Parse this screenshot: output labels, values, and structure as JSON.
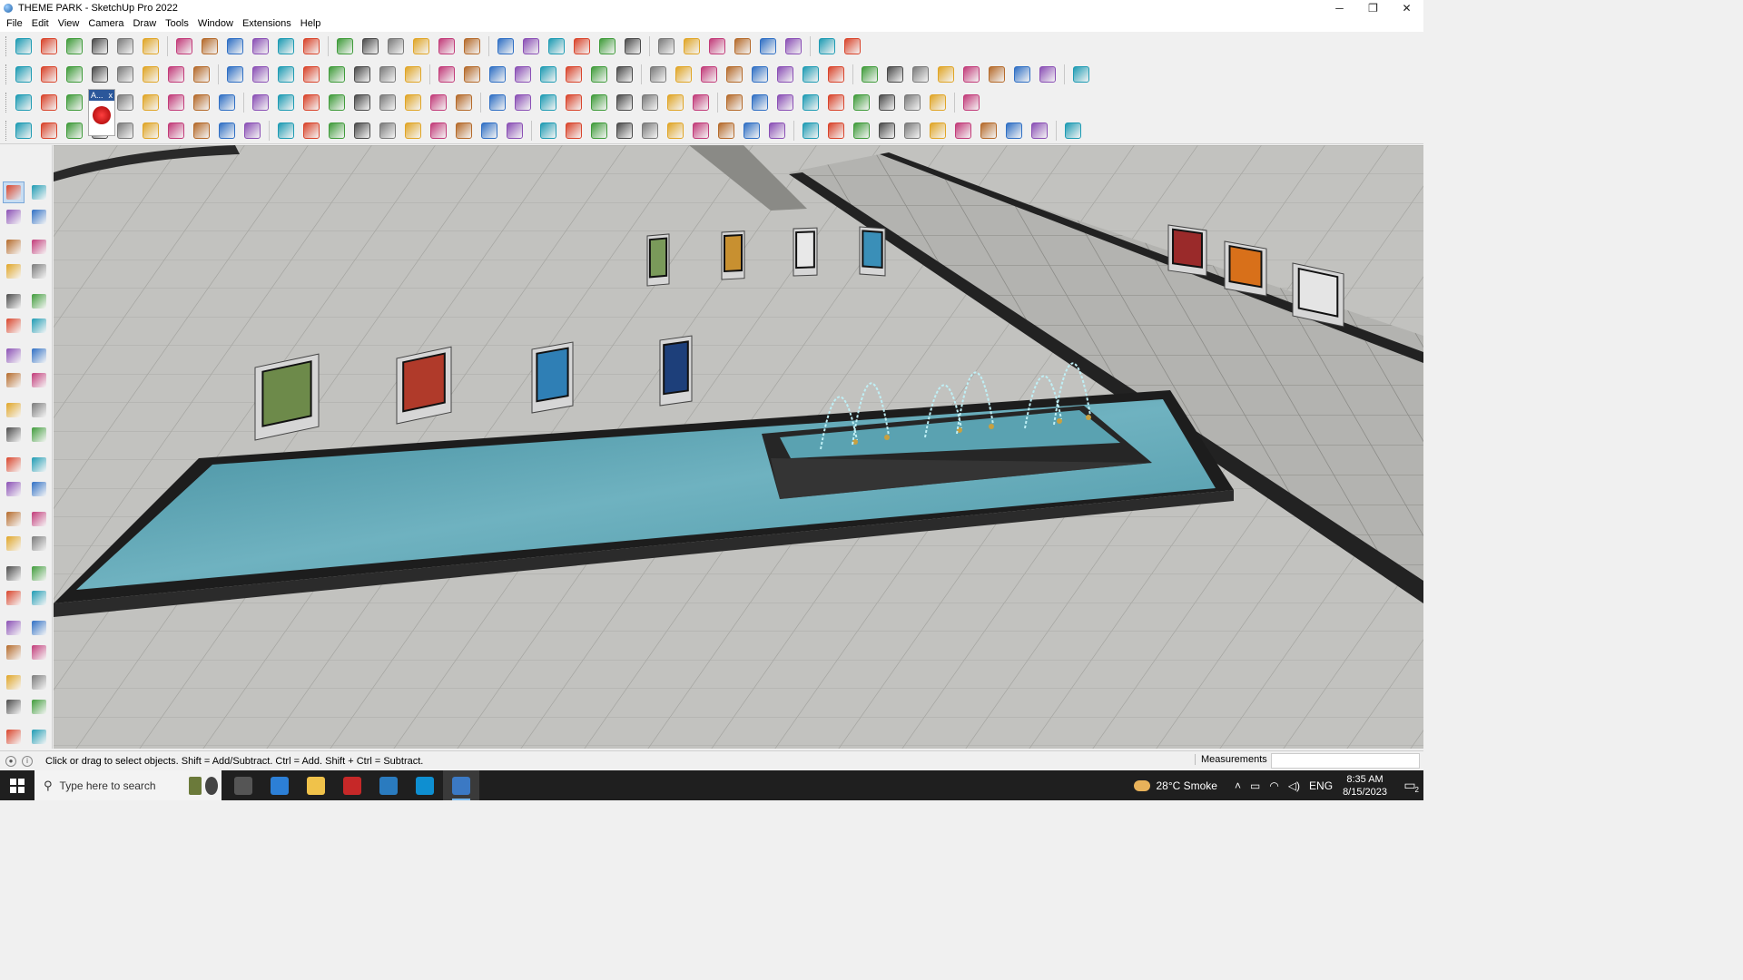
{
  "window": {
    "title": "THEME PARK - SketchUp Pro 2022",
    "app_icon": "sketchup-icon",
    "controls": {
      "minimize": "─",
      "maximize": "❐",
      "close": "✕"
    }
  },
  "menu": {
    "items": [
      "File",
      "Edit",
      "View",
      "Camera",
      "Draw",
      "Tools",
      "Window",
      "Extensions",
      "Help"
    ]
  },
  "toolbars": {
    "row1_icons": [
      "zoom-window-icon",
      "select-icon",
      "eraser-icon",
      "pencil-icon",
      "lasso-icon",
      "rectangle-icon",
      "push-pull-icon",
      "follow-me-icon",
      "move-icon",
      "rotate-icon",
      "scale-icon",
      "tape-icon",
      "text-icon",
      "paint-bucket-icon",
      "orbit-icon",
      "pan-icon",
      "zoom-icon",
      "zoom-extents-icon",
      "section-icon",
      "layers-icon",
      "styles-icon",
      "components-icon",
      "camera-icon",
      "axes-icon",
      "dimensions-icon",
      "protractor-icon",
      "solid-icon",
      "intersect-icon",
      "explode-icon",
      "undo-icon",
      "redo-icon",
      "hand-icon"
    ],
    "row2_icons": [
      "box-icon",
      "iso-view-icon",
      "top-view-icon",
      "front-view-icon",
      "right-view-icon",
      "back-view-icon",
      "left-view-icon",
      "bottom-view-icon",
      "xray-icon",
      "wireframe-icon",
      "hidden-line-icon",
      "shaded-icon",
      "textured-icon",
      "monochrome-icon",
      "house-icon",
      "house-icon",
      "house-icon",
      "house-icon",
      "house-icon",
      "measure-icon",
      "tag-icon",
      "pencil-icon",
      "rect-icon",
      "circle-icon",
      "polygon-icon",
      "ellipse-icon",
      "parallelogram-icon",
      "arc-icon",
      "spline-icon",
      "bezier-icon",
      "curve-icon",
      "curve-icon",
      "ruler-icon",
      "eraser-icon",
      "sandbox-icon",
      "grid-icon",
      "drape-icon",
      "stamp-icon",
      "flip-icon",
      "smoove-icon",
      "detail-icon"
    ],
    "row3_icons": [
      "paint-icon",
      "paint-icon",
      "paint-icon",
      "window-popup-icon",
      "layer-icon",
      "curl-icon",
      "square-icon",
      "panel-icon",
      "door-icon",
      "stair-icon",
      "roof-icon",
      "wall-icon",
      "link-icon",
      "plus-icon",
      "plus-icon",
      "cross-icon",
      "cone-icon",
      "tree-icon",
      "warning-icon",
      "loop-icon",
      "knot-icon",
      "twist-icon",
      "star-icon",
      "cup-icon",
      "magnet-icon",
      "puzzle-icon",
      "cube-icon",
      "cube-icon",
      "chair-icon",
      "frame-icon",
      "tiles-icon",
      "grid-icon",
      "grid-icon",
      "grid-icon",
      "close-x-icon",
      "dots-icon",
      "layout-icon"
    ],
    "row4_icons": [
      "bezier-icon",
      "curve-icon",
      "paint-icon",
      "ruby-icon",
      "gear-icon",
      "curtain-icon",
      "curtain-icon",
      "shell-icon",
      "shell-icon",
      "shell-icon",
      "line-icon",
      "line-icon",
      "line-icon",
      "curve-icon",
      "rail-icon",
      "cone-icon",
      "fan-icon",
      "fan-icon",
      "hand-icon",
      "leaf-icon",
      "arrow-icon",
      "stack-icon",
      "slash-icon",
      "bar-icon",
      "bar-icon",
      "bar-icon",
      "bucket-icon",
      "hatch-icon",
      "hatch-icon",
      "hatch-icon",
      "hatch-icon",
      "hatch-icon",
      "hatch-icon",
      "hatch-icon",
      "hatch-icon",
      "hatch-icon",
      "hatch-icon",
      "hatch-icon",
      "hatch-icon",
      "hatch-icon",
      "shape-icon"
    ],
    "floating_panel": {
      "label": "A...",
      "close": "x"
    }
  },
  "left_palette": {
    "icons": [
      "select-icon",
      "orbit-icon",
      "paint-bucket-icon",
      "eraser-icon",
      "component-icon",
      "tape-icon",
      "pencil-icon",
      "freehand-icon",
      "rectangle-icon",
      "rotated-rect-icon",
      "circle-icon",
      "polygon-icon",
      "arc-icon",
      "arc2-icon",
      "pie-icon",
      "three-point-arc-icon",
      "move-icon",
      "push-pull-icon",
      "rotate-icon",
      "follow-me-icon",
      "scale-icon",
      "offset-icon",
      "tape-measure-icon",
      "dimension-icon",
      "protractor-icon",
      "text-icon",
      "axes-icon",
      "3d-text-icon",
      "orbit2-icon",
      "pan-icon",
      "zoom-icon",
      "zoom-window-icon",
      "zoom-extents-icon",
      "previous-view-icon",
      "position-camera-icon",
      "look-around-icon",
      "walk-icon",
      "section-plane-icon",
      "section-display-icon",
      "section-cut-icon",
      "layers-icon",
      "styles-icon"
    ]
  },
  "viewport": {
    "scene_label": "Theme park model with reflecting pool, fountain jets and information signboards"
  },
  "statusbar": {
    "hint": "Click or drag to select objects. Shift = Add/Subtract. Ctrl = Add. Shift + Ctrl = Subtract.",
    "measurements_label": "Measurements",
    "measurements_value": ""
  },
  "taskbar": {
    "search_placeholder": "Type here to search",
    "apps": [
      "task-view-icon",
      "calculator-icon",
      "file-explorer-icon",
      "acrobat-icon",
      "store-icon",
      "edge-icon",
      "sketchup-icon"
    ],
    "weather": "28°C  Smoke",
    "language": "ENG",
    "time": "8:35 AM",
    "date": "8/15/2023",
    "notification_count": "2"
  },
  "colors": {
    "ground": "#bfbfbb",
    "water": "#4f97a8",
    "pool_border": "#2d2d2d",
    "accent": "#0078d4"
  }
}
